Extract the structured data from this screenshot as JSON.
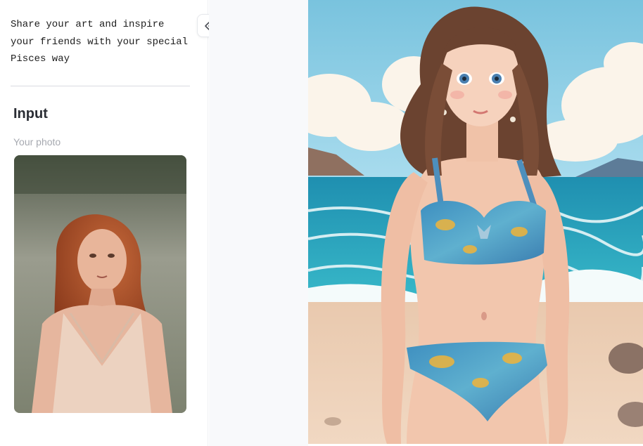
{
  "sidebar": {
    "share_text": "Share your art and inspire\nyour friends with your special\nPisces way",
    "input_section_title": "Input",
    "photo_label": "Your photo"
  },
  "icons": {
    "collapse": "double-chevron-left-icon"
  },
  "colors": {
    "sidebar_bg": "#ffffff",
    "canvas_bg": "#f8f9fb",
    "divider": "#d9dbe0",
    "label_muted": "#a6a9b0"
  }
}
